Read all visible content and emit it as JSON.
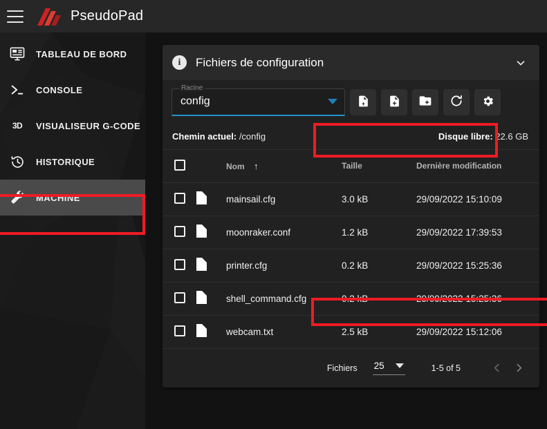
{
  "topbar": {
    "menu_icon": "hamburger-icon",
    "logo_icon": "pseudopad-logo",
    "brand": "PseudoPad"
  },
  "sidebar": {
    "items": [
      {
        "label": "TABLEAU DE BORD",
        "icon": "dashboard-icon",
        "active": false
      },
      {
        "label": "CONSOLE",
        "icon": "terminal-icon",
        "active": false
      },
      {
        "label": "VISUALISEUR G-CODE",
        "icon": "3d-icon",
        "active": false
      },
      {
        "label": "HISTORIQUE",
        "icon": "history-icon",
        "active": false
      },
      {
        "label": "MACHINE",
        "icon": "wrench-icon",
        "active": true
      }
    ]
  },
  "card": {
    "header": {
      "icon": "info-icon",
      "title": "Fichiers de configuration",
      "collapse_icon": "chevron-down-icon"
    },
    "toolbar": {
      "root_select": {
        "label": "Racine",
        "value": "config",
        "dropdown_icon": "triangle-down-icon"
      },
      "buttons": [
        {
          "name": "upload-file-button",
          "icon": "file-upload-icon"
        },
        {
          "name": "new-file-button",
          "icon": "file-plus-icon"
        },
        {
          "name": "new-folder-button",
          "icon": "folder-plus-icon"
        },
        {
          "name": "refresh-button",
          "icon": "refresh-icon"
        },
        {
          "name": "settings-button",
          "icon": "gear-icon"
        }
      ]
    },
    "path_bar": {
      "current_path_label": "Chemin actuel:",
      "current_path_value": "/config",
      "free_disk_label": "Disque libre:",
      "free_disk_value": "22.6 GB"
    },
    "table": {
      "select_all_icon": "checkbox-icon",
      "columns": {
        "name": "Nom",
        "sort_icon": "arrow-up-icon",
        "size": "Taille",
        "modified": "Dernière modification"
      },
      "rows": [
        {
          "icon": "file-icon",
          "name": "mainsail.cfg",
          "size": "3.0 kB",
          "modified": "29/09/2022 15:10:09",
          "highlighted": false
        },
        {
          "icon": "file-icon",
          "name": "moonraker.conf",
          "size": "1.2 kB",
          "modified": "29/09/2022 17:39:53",
          "highlighted": false
        },
        {
          "icon": "file-icon",
          "name": "printer.cfg",
          "size": "0.2 kB",
          "modified": "29/09/2022 15:25:36",
          "highlighted": true
        },
        {
          "icon": "file-icon",
          "name": "shell_command.cfg",
          "size": "0.2 kB",
          "modified": "29/09/2022 15:25:36",
          "highlighted": false
        },
        {
          "icon": "file-icon",
          "name": "webcam.txt",
          "size": "2.5 kB",
          "modified": "29/09/2022 15:12:06",
          "highlighted": false
        }
      ]
    },
    "footer": {
      "items_label": "Fichiers",
      "per_page": "25",
      "per_page_icon": "triangle-down-icon",
      "range": "1-5 of 5",
      "prev_icon": "chevron-left-icon",
      "next_icon": "chevron-right-icon"
    }
  },
  "annotations": {
    "highlight_color": "#ef1b24",
    "boxes": [
      {
        "name": "machine-nav-highlight"
      },
      {
        "name": "root-select-highlight"
      },
      {
        "name": "printer-cfg-row-highlight"
      }
    ]
  },
  "colors": {
    "accent_red": "#e02b27",
    "select_underline": "#2196c9",
    "page_bg": "#121212",
    "card_bg": "#212121",
    "topbar_bg": "#272727"
  }
}
